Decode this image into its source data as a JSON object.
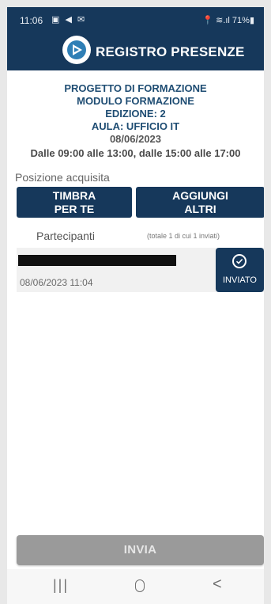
{
  "status_bar": {
    "time": "11:06",
    "left_icons": "▣ ◀ ✉",
    "right_text": "📍 ≋.ıl 71%▮"
  },
  "header": {
    "title": "REGISTRO PRESENZE"
  },
  "session": {
    "project": "PROGETTO DI FORMAZIONE",
    "module": "MODULO FORMAZIONE",
    "edition": "EDIZIONE: 2",
    "room": "AULA: UFFICIO IT",
    "date": "08/06/2023",
    "hours": "Dalle 09:00 alle 13:00, dalle 15:00 alle 17:00"
  },
  "position_label": "Posizione acquisita",
  "buttons": {
    "timbra_line1": "TIMBRA",
    "timbra_line2": "PER TE",
    "aggiungi_line1": "AGGIUNGI",
    "aggiungi_line2": "ALTRI",
    "invia": "INVIA"
  },
  "participants": {
    "title": "Partecipanti",
    "total": "(totale 1 di cui 1 inviati)",
    "items": [
      {
        "datetime": "08/06/2023 11:04",
        "status": "INVIATO"
      }
    ]
  },
  "nav": {
    "recents": "|||",
    "back": "<"
  },
  "colors": {
    "primary": "#16385b",
    "info_text": "#1f4d73",
    "disabled_button": "#9a9a9a"
  },
  "icons": [
    "app-logo-icon",
    "check-circle-icon",
    "location-icon",
    "wifi-icon",
    "signal-icon",
    "battery-icon"
  ]
}
